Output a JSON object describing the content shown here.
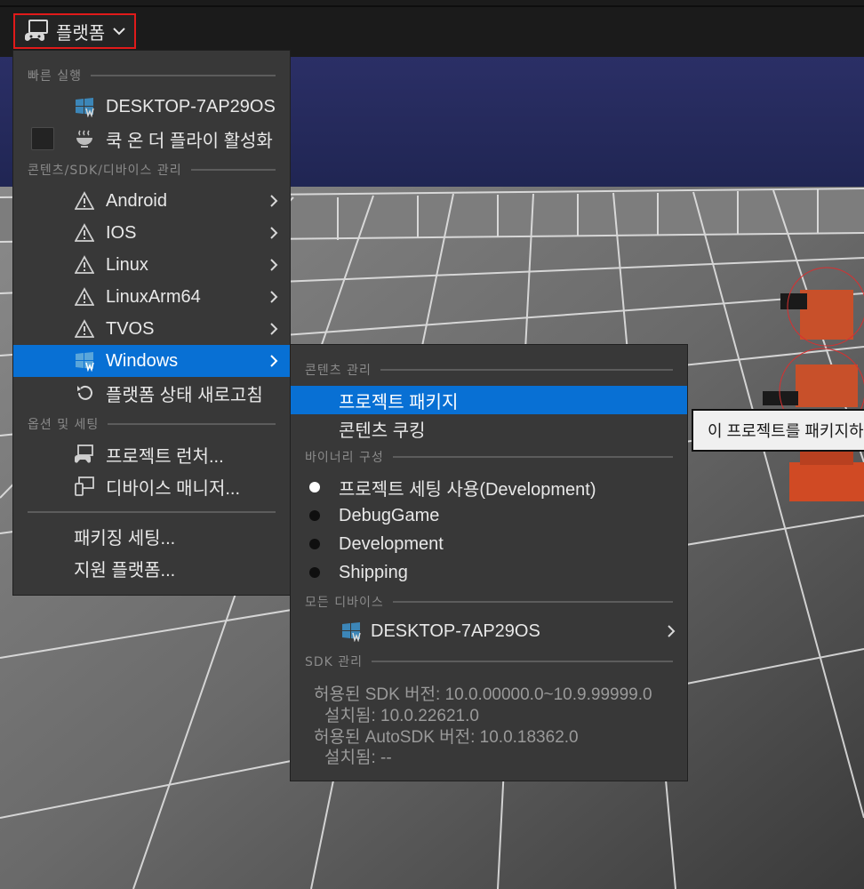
{
  "toolbar": {
    "platform_label": "플랫폼"
  },
  "main_menu": {
    "quick_launch_header": "빠른 실행",
    "device_label": "DESKTOP-7AP29OS",
    "cook_on_fly_label": "쿡 온 더 플라이 활성화",
    "content_sdk_header": "콘텐츠/SDK/디바이스 관리",
    "platforms": [
      {
        "label": "Android"
      },
      {
        "label": "IOS"
      },
      {
        "label": "Linux"
      },
      {
        "label": "LinuxArm64"
      },
      {
        "label": "TVOS"
      },
      {
        "label": "Windows"
      }
    ],
    "refresh_label": "플랫폼 상태 새로고침",
    "options_header": "옵션 및 세팅",
    "project_launcher_label": "프로젝트 런처...",
    "device_manager_label": "디바이스 매니저...",
    "packaging_settings_label": "패키징 세팅...",
    "supported_platforms_label": "지원 플랫폼..."
  },
  "sub_menu": {
    "content_header": "콘텐츠 관리",
    "package_project": "프로젝트 패키지",
    "cook_content": "콘텐츠 쿠킹",
    "binary_header": "바이너리 구성",
    "configs": [
      {
        "label": "프로젝트 세팅 사용(Development)",
        "selected": true
      },
      {
        "label": "DebugGame",
        "selected": false
      },
      {
        "label": "Development",
        "selected": false
      },
      {
        "label": "Shipping",
        "selected": false
      }
    ],
    "all_devices_header": "모든 디바이스",
    "device_label": "DESKTOP-7AP29OS",
    "sdk_header": "SDK 관리",
    "sdk_allowed": "허용된 SDK 버전: 10.0.00000.0~10.9.99999.0",
    "sdk_installed": "설치됨: 10.0.22621.0",
    "autosdk_allowed": "허용된 AutoSDK 버전: 10.0.18362.0",
    "autosdk_installed": "설치됨: --"
  },
  "tooltip": {
    "text": "이 프로젝트를 패키지하"
  },
  "colors": {
    "highlight": "#0870d4",
    "menu_bg": "#383838",
    "focus_border": "#e01a1a"
  }
}
